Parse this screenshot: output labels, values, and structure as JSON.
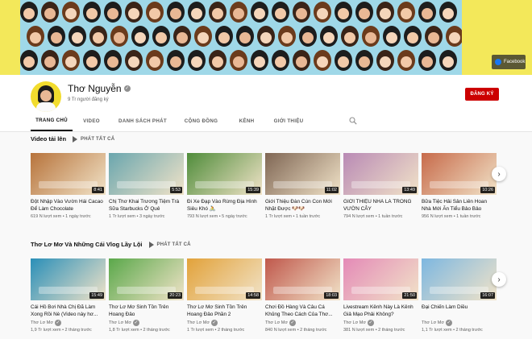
{
  "banner": {
    "facebook_label": "Facebook"
  },
  "channel": {
    "name": "Thơ Nguyễn",
    "subscribers": "9 Tr người đăng ký",
    "subscribe_label": "ĐĂNG KÝ"
  },
  "tabs": [
    {
      "label": "TRANG CHỦ",
      "active": true
    },
    {
      "label": "VIDEO",
      "active": false
    },
    {
      "label": "DANH SÁCH PHÁT",
      "active": false
    },
    {
      "label": "CỘNG ĐỒNG",
      "active": false
    },
    {
      "label": "KÊNH",
      "active": false
    },
    {
      "label": "GIỚI THIỆU",
      "active": false
    }
  ],
  "sections": [
    {
      "title": "Video tải lên",
      "play_all": "PHÁT TẤT CẢ",
      "videos": [
        {
          "title": "Đột Nhập Vào Vườn Hái Cacao Để Làm Chocolate",
          "channel": "",
          "meta": "619 N lượt xem  •  1 ngày trước",
          "duration": "8:41",
          "color": "#b7733b"
        },
        {
          "title": "Chị Thơ Khai Trương Tiệm Trà Sữa Starbucks Ở Quê",
          "channel": "",
          "meta": "1 Tr lượt xem  •  3 ngày trước",
          "duration": "5:53",
          "color": "#6aa6ae"
        },
        {
          "title": "Đi Xe Đạp Vào Rừng Địa Hình Siêu Khó 🚴",
          "channel": "",
          "meta": "793 N lượt xem  •  5 ngày trước",
          "duration": "15:39",
          "color": "#4f8c3a"
        },
        {
          "title": "Giới Thiệu Đàn Cún Con Mới Nhặt Được 🐶🐶",
          "channel": "",
          "meta": "1 Tr lượt xem  •  1 tuần trước",
          "duration": "11:02",
          "color": "#7f6654"
        },
        {
          "title": "GIỚI THIỆU NHÀ LÁ TRONG VƯỜN CÂY",
          "channel": "",
          "meta": "794 N lượt xem  •  1 tuần trước",
          "duration": "13:49",
          "color": "#b98ab5"
        },
        {
          "title": "Bữa Tiệc Hải Sản Liên Hoan Nhà Mới Ăn Tiểu Bảo Bảo",
          "channel": "",
          "meta": "956 N lượt xem  •  1 tuần trước",
          "duration": "10:26",
          "color": "#c76a4a"
        }
      ]
    },
    {
      "title": "Thơ Lơ Mơ Và Những Cái Vlog Lầy Lội",
      "play_all": "PHÁT TẤT CẢ",
      "videos": [
        {
          "title": "Cái Hồ Bơi Nhà Chị Đã Làm Xong Rồi Nè (Video này hơ...",
          "channel": "Thơ Lơ Mơ",
          "meta": "1,9 Tr lượt xem  •  2 tháng trước",
          "duration": "15:49",
          "color": "#2a8fb8"
        },
        {
          "title": "Thơ Lơ Mơ Sinh Tồn Trên Hoang Đảo",
          "channel": "Thơ Lơ Mơ",
          "meta": "1,8 Tr lượt xem  •  2 tháng trước",
          "duration": "20:23",
          "color": "#5aa84a"
        },
        {
          "title": "Thơ Lơ Mơ Sinh Tồn Trên Hoang Đảo Phần 2",
          "channel": "Thơ Lơ Mơ",
          "meta": "1 Tr lượt xem  •  2 tháng trước",
          "duration": "14:58",
          "color": "#e2a23a"
        },
        {
          "title": "Chơi Đồ Hàng Và Câu Cá Khủng Theo Cách Của Thơ...",
          "channel": "Thơ Lơ Mơ",
          "meta": "840 N lượt xem  •  2 tháng trước",
          "duration": "18:03",
          "color": "#c0584c"
        },
        {
          "title": "Livestream Kênh Này Là Kênh Giả Mạo Phải Không?",
          "channel": "Thơ Lơ Mơ",
          "meta": "381 N lượt xem  •  2 tháng trước",
          "duration": "21:50",
          "color": "#e48ab7"
        },
        {
          "title": "Đại Chiến Làm Diều",
          "channel": "Thơ Lơ Mơ",
          "meta": "1,1 Tr lượt xem  •  2 tháng trước",
          "duration": "16:07",
          "color": "#7db7e0"
        }
      ]
    }
  ]
}
